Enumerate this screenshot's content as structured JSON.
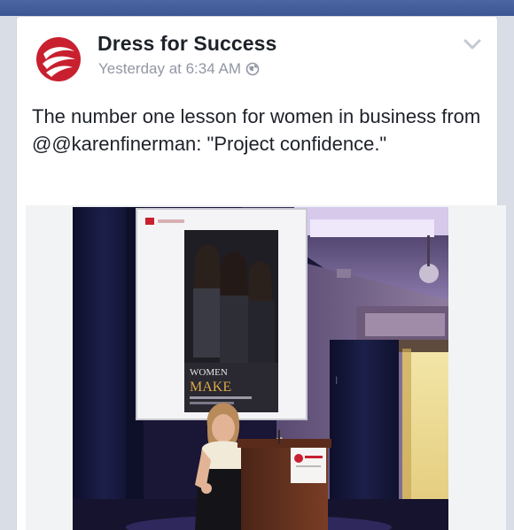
{
  "app": {
    "accent_color": "#3b5998"
  },
  "post": {
    "author": "Dress for Success",
    "timestamp": "Yesterday at 6:34 AM",
    "privacy_icon": "globe-icon",
    "menu_icon": "chevron-down-icon",
    "avatar_color": "#c8202f",
    "text": "The number one lesson for women in business from @@karenfinerman: \"Project confidence.\"",
    "photo": {
      "screen_headline_1": "WOMEN",
      "screen_headline_2": "MAKE"
    }
  }
}
